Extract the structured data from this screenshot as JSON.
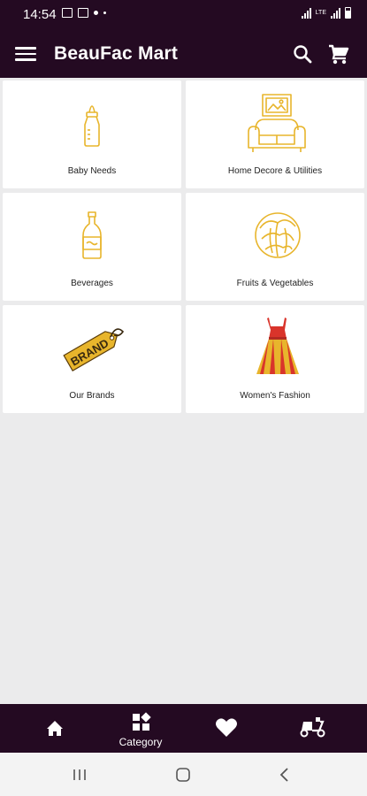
{
  "status_bar": {
    "time": "14:54",
    "network": "LTE",
    "signal_icon": "signal-icon",
    "battery_icon": "battery-icon"
  },
  "app_bar": {
    "title": "BeauFac Mart",
    "menu_icon": "hamburger-menu-icon",
    "search_icon": "search-icon",
    "cart_icon": "shopping-cart-icon"
  },
  "categories": [
    {
      "label": "Baby Needs",
      "icon": "baby-bottle-icon"
    },
    {
      "label": "Home Decore & Utilities",
      "icon": "sofa-picture-icon"
    },
    {
      "label": "Beverages",
      "icon": "bottle-icon"
    },
    {
      "label": "Fruits & Vegetables",
      "icon": "cabbage-icon"
    },
    {
      "label": "Our Brands",
      "icon": "brand-tag-icon",
      "tag_text": "BRAND"
    },
    {
      "label": "Women's Fashion",
      "icon": "dress-icon"
    }
  ],
  "bottom_nav": {
    "items": [
      {
        "label": "",
        "icon": "home-icon"
      },
      {
        "label": "Category",
        "icon": "category-icon"
      },
      {
        "label": "",
        "icon": "heart-icon"
      },
      {
        "label": "",
        "icon": "scooter-icon"
      }
    ]
  },
  "colors": {
    "brand_dark": "#240a22",
    "icon_gold": "#e8b52c",
    "background": "#ebebec"
  }
}
